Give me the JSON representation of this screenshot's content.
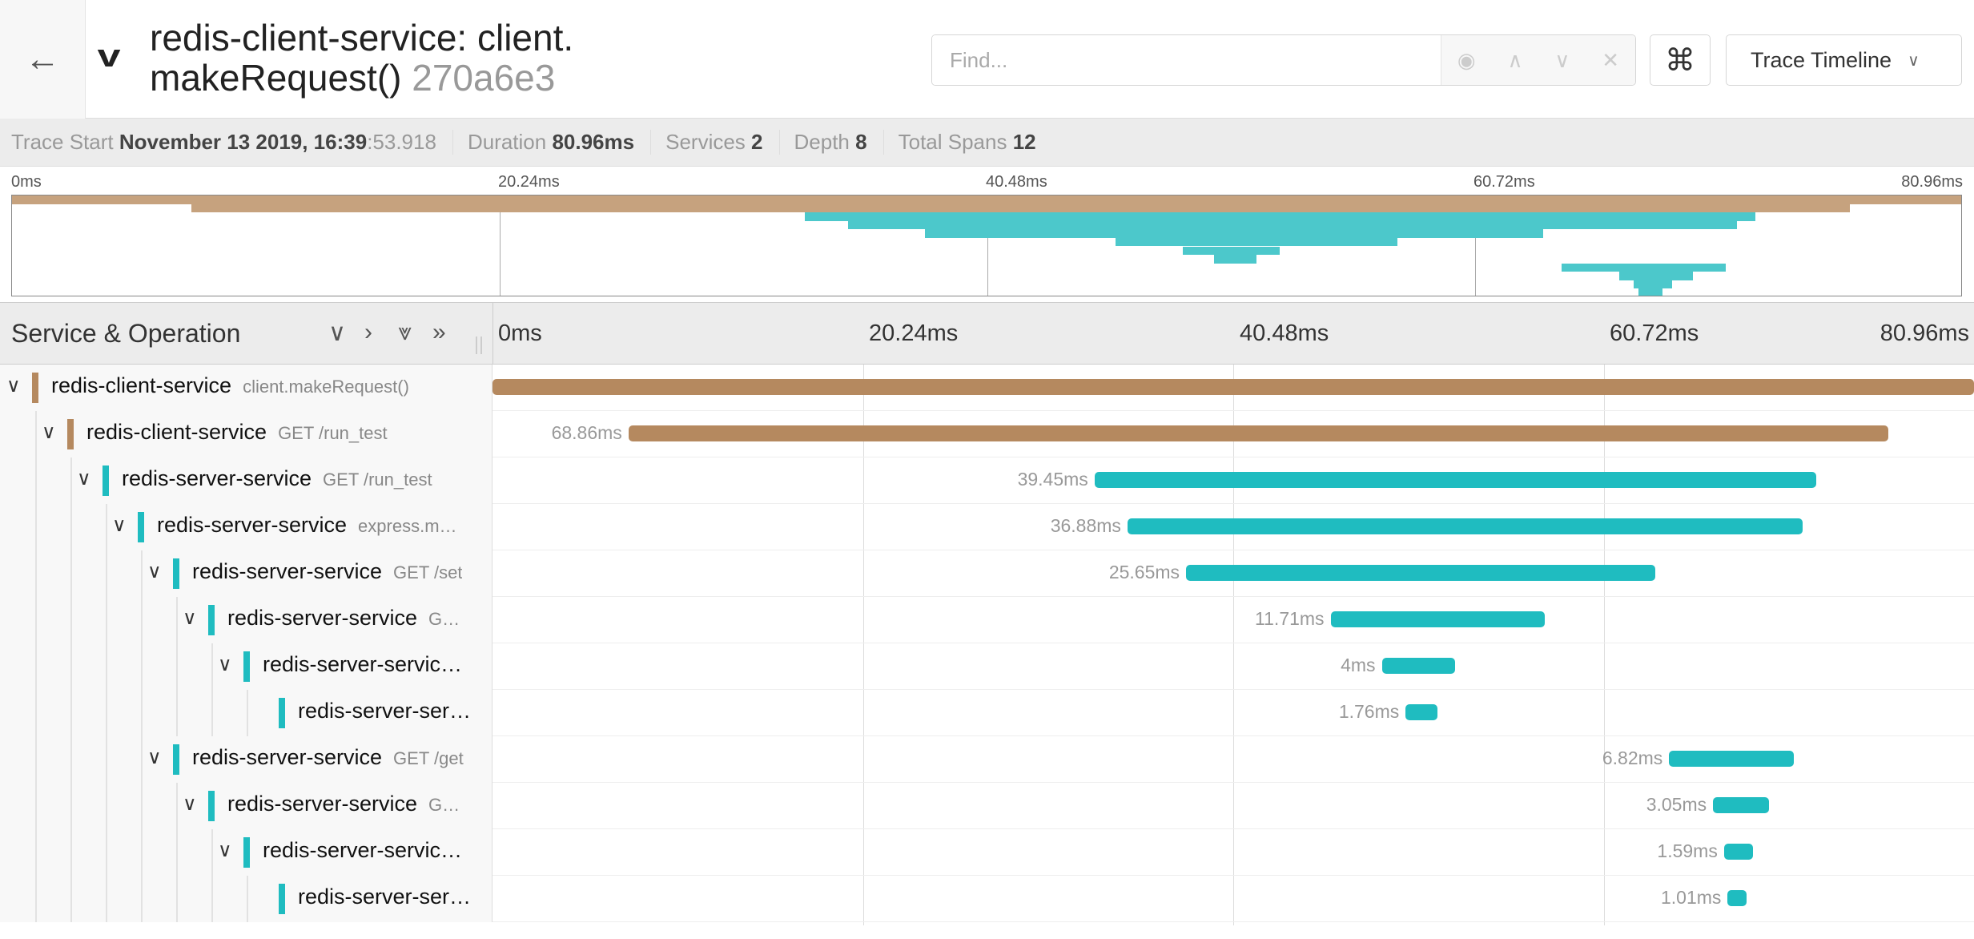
{
  "header": {
    "title_line1": "redis-client-service: client.",
    "title_line2": "makeRequest()",
    "trace_id": "270a6e3",
    "find_placeholder": "Find...",
    "view_label": "Trace Timeline"
  },
  "summary": {
    "trace_start_label": "Trace Start",
    "trace_start_value": "November 13 2019, 16:39",
    "trace_start_ms": ":53.918",
    "duration_label": "Duration",
    "duration_value": "80.96ms",
    "services_label": "Services",
    "services_value": "2",
    "depth_label": "Depth",
    "depth_value": "8",
    "total_spans_label": "Total Spans",
    "total_spans_value": "12"
  },
  "ticks": [
    "0ms",
    "20.24ms",
    "40.48ms",
    "60.72ms",
    "80.96ms"
  ],
  "total_ms": 80.96,
  "column_header": "Service & Operation",
  "colors": {
    "client": "#b5895f",
    "server": "#1fbcc0"
  },
  "spans": [
    {
      "service": "redis-client-service",
      "operation": "client.makeRequest()",
      "depth": 0,
      "start": 0,
      "duration": 80.96,
      "label": "",
      "kind": "client",
      "toggle": true
    },
    {
      "service": "redis-client-service",
      "operation": "GET /run_test",
      "depth": 1,
      "start": 7.43,
      "duration": 68.86,
      "label": "68.86ms",
      "kind": "client",
      "toggle": true
    },
    {
      "service": "redis-server-service",
      "operation": "GET /run_test",
      "depth": 2,
      "start": 32.9,
      "duration": 39.45,
      "label": "39.45ms",
      "kind": "server",
      "toggle": true
    },
    {
      "service": "redis-server-service",
      "operation": "express.m…",
      "depth": 3,
      "start": 34.7,
      "duration": 36.88,
      "label": "36.88ms",
      "kind": "server",
      "toggle": true
    },
    {
      "service": "redis-server-service",
      "operation": "GET /set",
      "depth": 4,
      "start": 37.9,
      "duration": 25.65,
      "label": "25.65ms",
      "kind": "server",
      "toggle": true
    },
    {
      "service": "redis-server-service",
      "operation": "G…",
      "depth": 5,
      "start": 45.8,
      "duration": 11.71,
      "label": "11.71ms",
      "kind": "server",
      "toggle": true
    },
    {
      "service": "redis-server-servic…",
      "operation": "",
      "depth": 6,
      "start": 48.6,
      "duration": 4,
      "label": "4ms",
      "kind": "server",
      "toggle": true
    },
    {
      "service": "redis-server-ser…",
      "operation": "",
      "depth": 7,
      "start": 49.9,
      "duration": 1.76,
      "label": "1.76ms",
      "kind": "server",
      "toggle": false
    },
    {
      "service": "redis-server-service",
      "operation": "GET /get",
      "depth": 4,
      "start": 64.3,
      "duration": 6.82,
      "label": "6.82ms",
      "kind": "server",
      "toggle": true
    },
    {
      "service": "redis-server-service",
      "operation": "G…",
      "depth": 5,
      "start": 66.7,
      "duration": 3.05,
      "label": "3.05ms",
      "kind": "server",
      "toggle": true
    },
    {
      "service": "redis-server-servic…",
      "operation": "",
      "depth": 6,
      "start": 67.3,
      "duration": 1.59,
      "label": "1.59ms",
      "kind": "server",
      "toggle": true
    },
    {
      "service": "redis-server-ser…",
      "operation": "",
      "depth": 7,
      "start": 67.5,
      "duration": 1.01,
      "label": "1.01ms",
      "kind": "server",
      "toggle": false
    }
  ]
}
